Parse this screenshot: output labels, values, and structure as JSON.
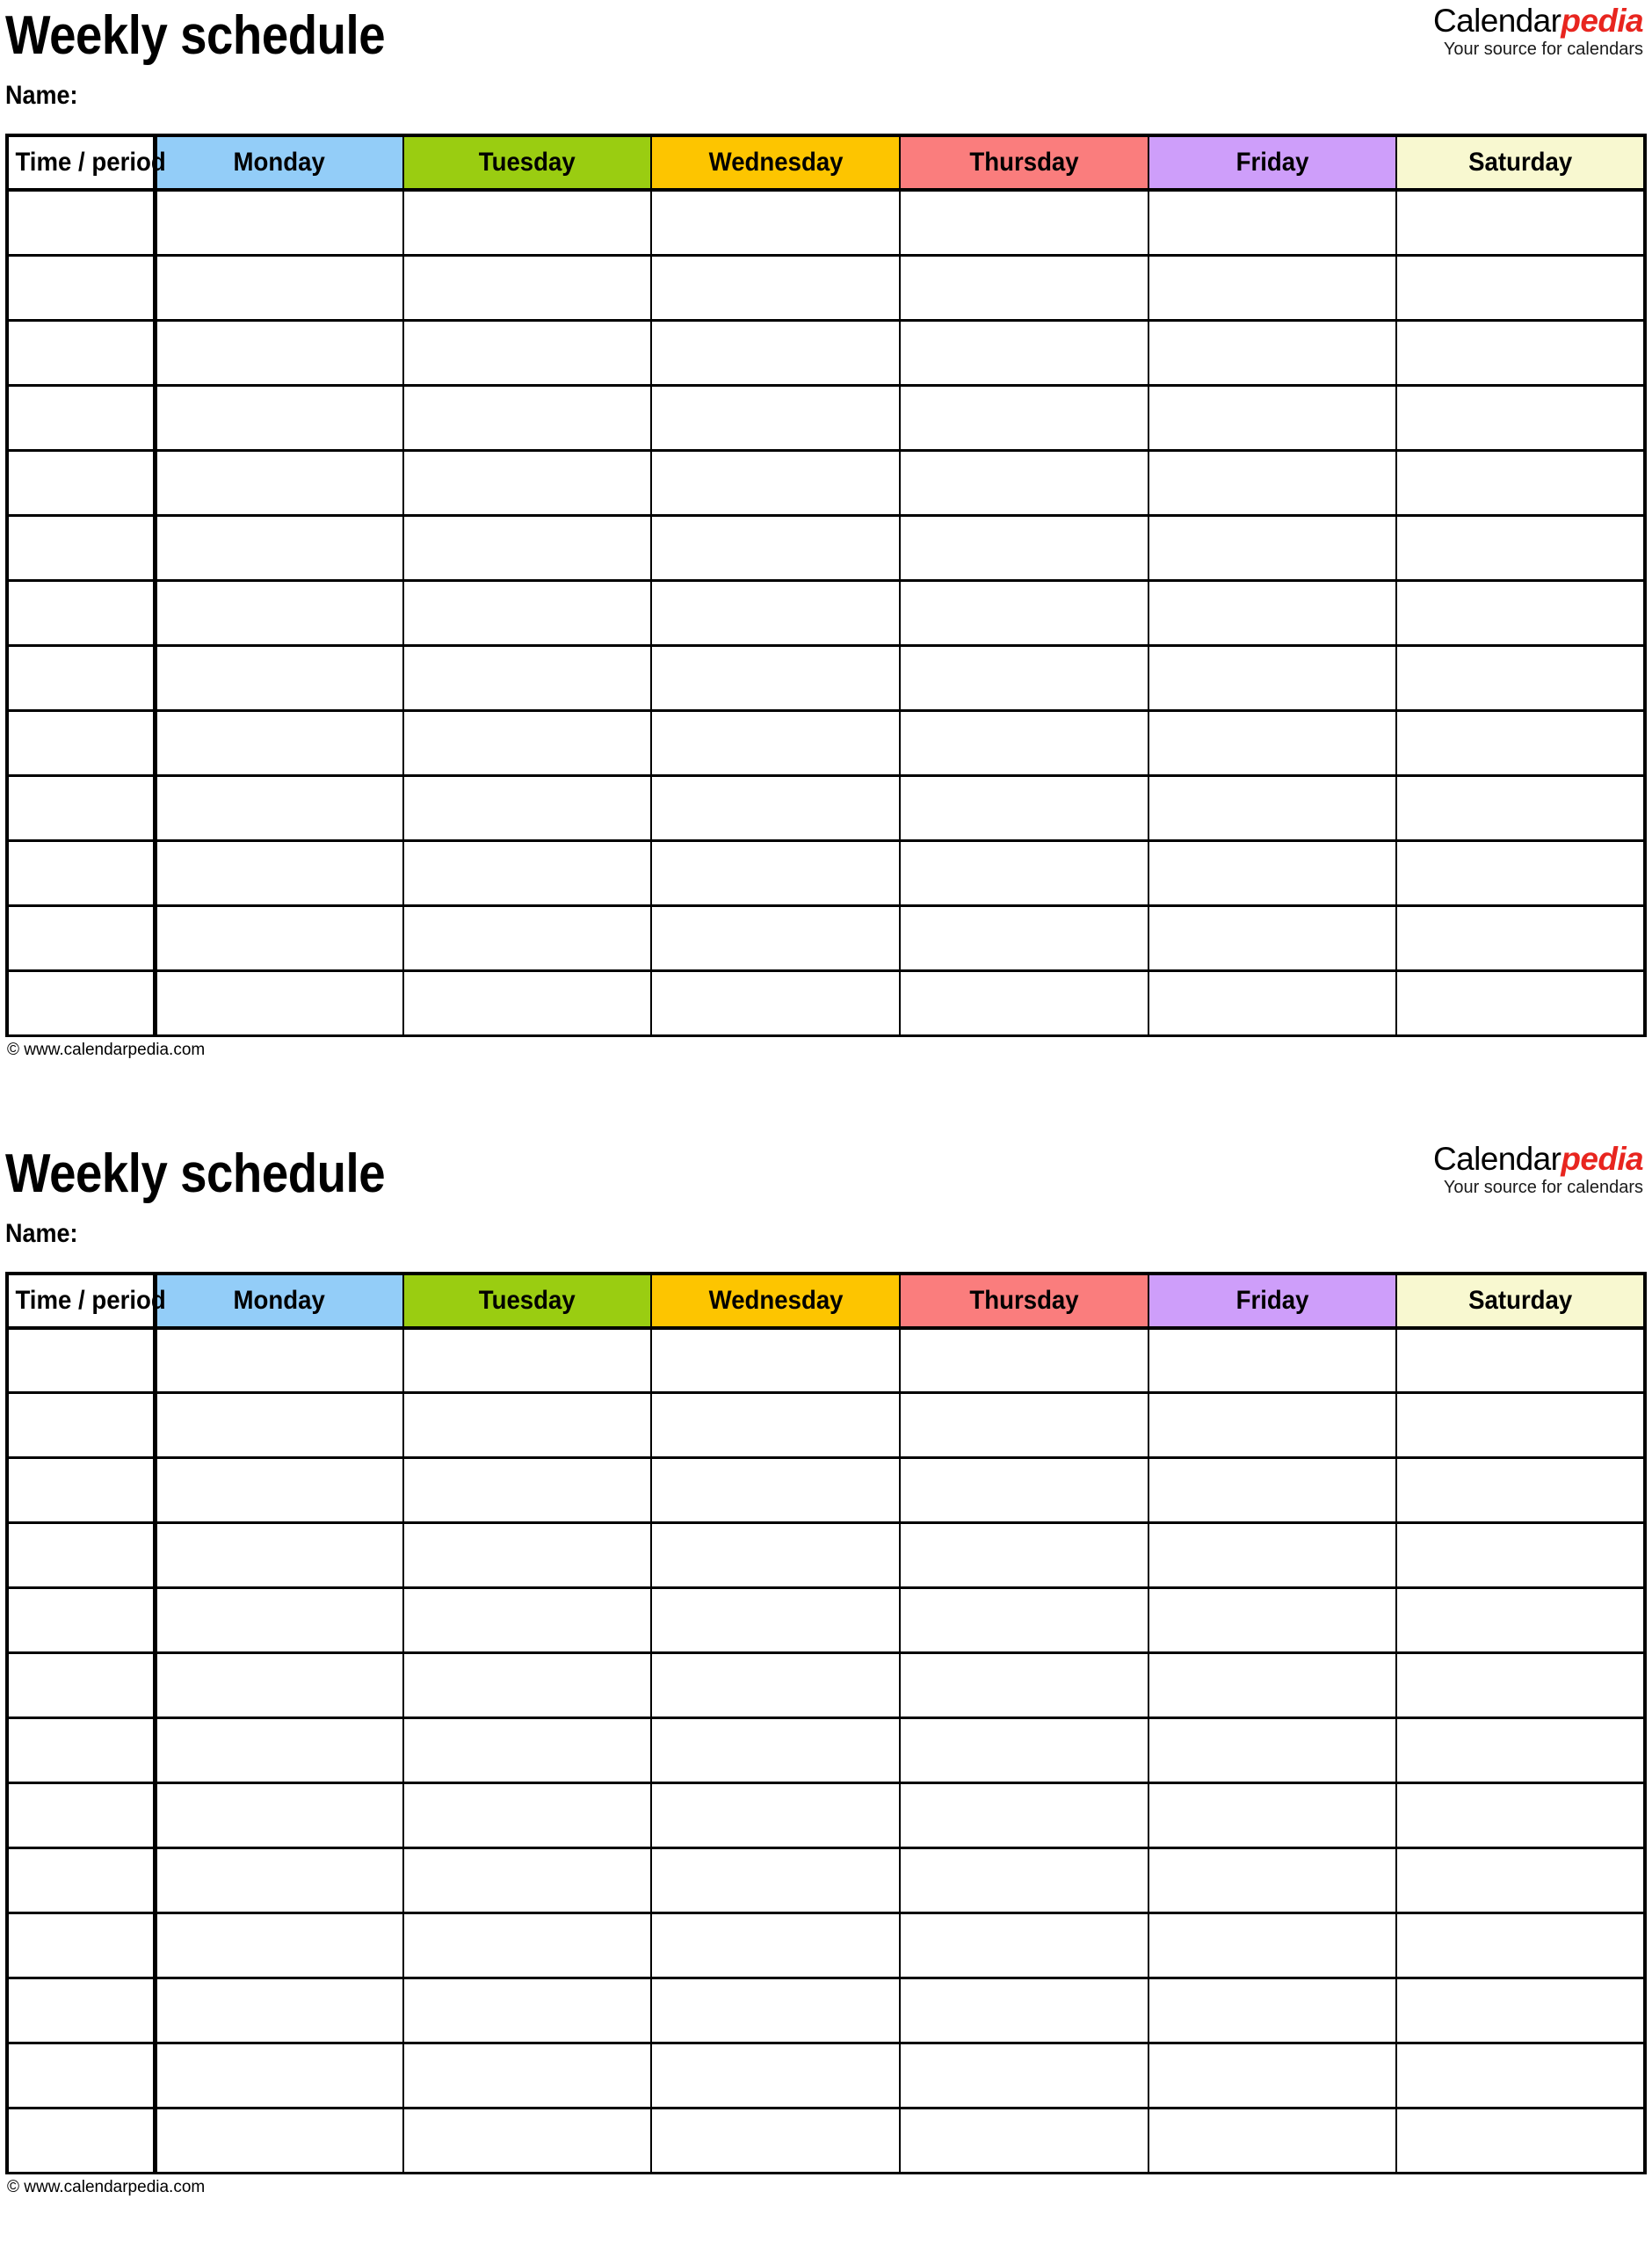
{
  "document": {
    "kind": "weekly-schedule-template",
    "blocks_on_page": 2
  },
  "brand": {
    "logo_primary": "Calendar",
    "logo_accent": "pedia",
    "tagline": "Your source for calendars",
    "accent_color": "#e8251f",
    "footer_credit": "© www.calendarpedia.com"
  },
  "schedule_1": {
    "title": "Weekly schedule",
    "name_label": "Name:",
    "footer": "© www.calendarpedia.com",
    "columns": [
      {
        "label": "Time / period",
        "color": "#ffffff"
      },
      {
        "label": "Monday",
        "color": "#93cdf8"
      },
      {
        "label": "Tuesday",
        "color": "#9acd11"
      },
      {
        "label": "Wednesday",
        "color": "#fdc500"
      },
      {
        "label": "Thursday",
        "color": "#fa7d7d"
      },
      {
        "label": "Friday",
        "color": "#ce9efa"
      },
      {
        "label": "Saturday",
        "color": "#f8f8d0"
      }
    ],
    "row_count": 13,
    "rows": [
      [
        "",
        "",
        "",
        "",
        "",
        "",
        ""
      ],
      [
        "",
        "",
        "",
        "",
        "",
        "",
        ""
      ],
      [
        "",
        "",
        "",
        "",
        "",
        "",
        ""
      ],
      [
        "",
        "",
        "",
        "",
        "",
        "",
        ""
      ],
      [
        "",
        "",
        "",
        "",
        "",
        "",
        ""
      ],
      [
        "",
        "",
        "",
        "",
        "",
        "",
        ""
      ],
      [
        "",
        "",
        "",
        "",
        "",
        "",
        ""
      ],
      [
        "",
        "",
        "",
        "",
        "",
        "",
        ""
      ],
      [
        "",
        "",
        "",
        "",
        "",
        "",
        ""
      ],
      [
        "",
        "",
        "",
        "",
        "",
        "",
        ""
      ],
      [
        "",
        "",
        "",
        "",
        "",
        "",
        ""
      ],
      [
        "",
        "",
        "",
        "",
        "",
        "",
        ""
      ],
      [
        "",
        "",
        "",
        "",
        "",
        "",
        ""
      ]
    ]
  },
  "schedule_2": {
    "title": "Weekly schedule",
    "name_label": "Name:",
    "footer": "© www.calendarpedia.com",
    "columns": [
      {
        "label": "Time / period",
        "color": "#ffffff"
      },
      {
        "label": "Monday",
        "color": "#93cdf8"
      },
      {
        "label": "Tuesday",
        "color": "#9acd11"
      },
      {
        "label": "Wednesday",
        "color": "#fdc500"
      },
      {
        "label": "Thursday",
        "color": "#fa7d7d"
      },
      {
        "label": "Friday",
        "color": "#ce9efa"
      },
      {
        "label": "Saturday",
        "color": "#f8f8d0"
      }
    ],
    "row_count": 13,
    "rows": [
      [
        "",
        "",
        "",
        "",
        "",
        "",
        ""
      ],
      [
        "",
        "",
        "",
        "",
        "",
        "",
        ""
      ],
      [
        "",
        "",
        "",
        "",
        "",
        "",
        ""
      ],
      [
        "",
        "",
        "",
        "",
        "",
        "",
        ""
      ],
      [
        "",
        "",
        "",
        "",
        "",
        "",
        ""
      ],
      [
        "",
        "",
        "",
        "",
        "",
        "",
        ""
      ],
      [
        "",
        "",
        "",
        "",
        "",
        "",
        ""
      ],
      [
        "",
        "",
        "",
        "",
        "",
        "",
        ""
      ],
      [
        "",
        "",
        "",
        "",
        "",
        "",
        ""
      ],
      [
        "",
        "",
        "",
        "",
        "",
        "",
        ""
      ],
      [
        "",
        "",
        "",
        "",
        "",
        "",
        ""
      ],
      [
        "",
        "",
        "",
        "",
        "",
        "",
        ""
      ],
      [
        "",
        "",
        "",
        "",
        "",
        "",
        ""
      ]
    ]
  }
}
